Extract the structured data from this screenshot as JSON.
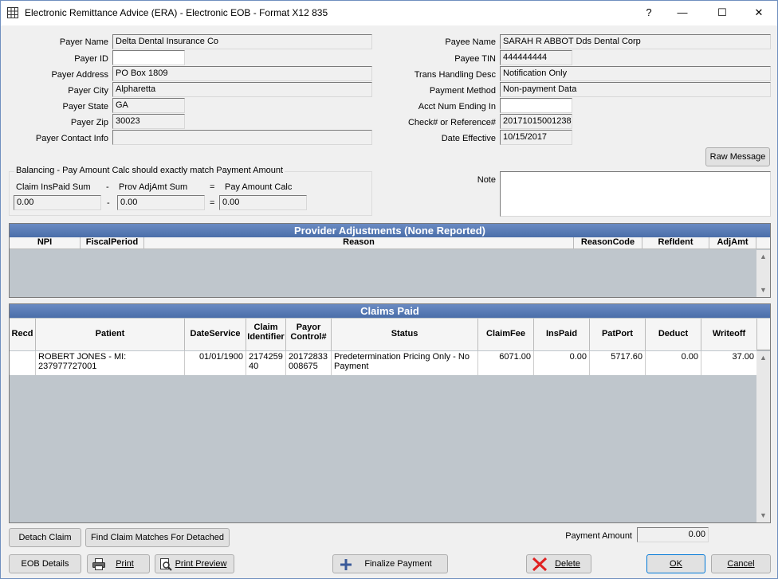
{
  "window": {
    "title": "Electronic Remittance Advice (ERA) - Electronic EOB - Format X12 835",
    "help": "?",
    "minimize": "—",
    "maximize": "☐",
    "close": "✕"
  },
  "payer": {
    "name_label": "Payer Name",
    "name": "Delta Dental Insurance Co",
    "id_label": "Payer ID",
    "id": "",
    "address_label": "Payer Address",
    "address": "PO Box 1809",
    "city_label": "Payer City",
    "city": "Alpharetta",
    "state_label": "Payer State",
    "state": "GA",
    "zip_label": "Payer Zip",
    "zip": "30023",
    "contact_label": "Payer Contact Info",
    "contact": ""
  },
  "payee": {
    "name_label": "Payee Name",
    "name": "SARAH R ABBOT Dds Dental Corp",
    "tin_label": "Payee TIN",
    "tin": "444444444",
    "trans_label": "Trans Handling Desc",
    "trans": "Notification Only",
    "method_label": "Payment Method",
    "method": "Non-payment Data",
    "acct_label": "Acct Num Ending In",
    "acct": "",
    "check_label": "Check# or Reference#",
    "check": "20171015001238",
    "date_label": "Date Effective",
    "date": "10/15/2017"
  },
  "raw_message_button": "Raw Message",
  "note_label": "Note",
  "balancing": {
    "title": "Balancing - Pay Amount Calc should exactly match Payment Amount",
    "claim_label": "Claim InsPaid Sum",
    "minus1": "-",
    "adj_label": "Prov AdjAmt Sum",
    "equals1": "=",
    "calc_label": "Pay Amount Calc",
    "claim_value": "0.00",
    "minus2": "-",
    "adj_value": "0.00",
    "equals2": "=",
    "calc_value": "0.00"
  },
  "provider_adjustments": {
    "title": "Provider Adjustments (None Reported)",
    "columns": [
      "NPI",
      "FiscalPeriod",
      "Reason",
      "ReasonCode",
      "RefIdent",
      "AdjAmt"
    ]
  },
  "claims_paid": {
    "title": "Claims Paid",
    "columns": [
      "Recd",
      "Patient",
      "DateService",
      "Claim Identifier",
      "Payor Control#",
      "Status",
      "ClaimFee",
      "InsPaid",
      "PatPort",
      "Deduct",
      "Writeoff"
    ],
    "rows": [
      {
        "recd": "",
        "patient": "ROBERT JONES - MI: 237977727001",
        "date_service": "01/01/1900",
        "claim_identifier": "217425940",
        "payor_control": "20172833008675",
        "status": "Predetermination Pricing Only - No Payment",
        "claim_fee": "6071.00",
        "ins_paid": "0.00",
        "pat_port": "5717.60",
        "deduct": "0.00",
        "writeoff": "37.00"
      }
    ]
  },
  "payment_amount_label": "Payment Amount",
  "payment_amount": "0.00",
  "buttons": {
    "detach_claim": "Detach Claim",
    "find_matches": "Find Claim Matches For Detached",
    "eob_details": "EOB Details",
    "print": "Print",
    "print_preview": "Print Preview",
    "finalize_payment": "Finalize Payment",
    "delete": "Delete",
    "ok": "OK",
    "cancel": "Cancel"
  },
  "icons": {
    "app": "grid-icon",
    "print": "printer-icon",
    "print_preview": "magnifier-page-icon",
    "finalize": "plus-icon",
    "delete": "red-x-icon"
  }
}
